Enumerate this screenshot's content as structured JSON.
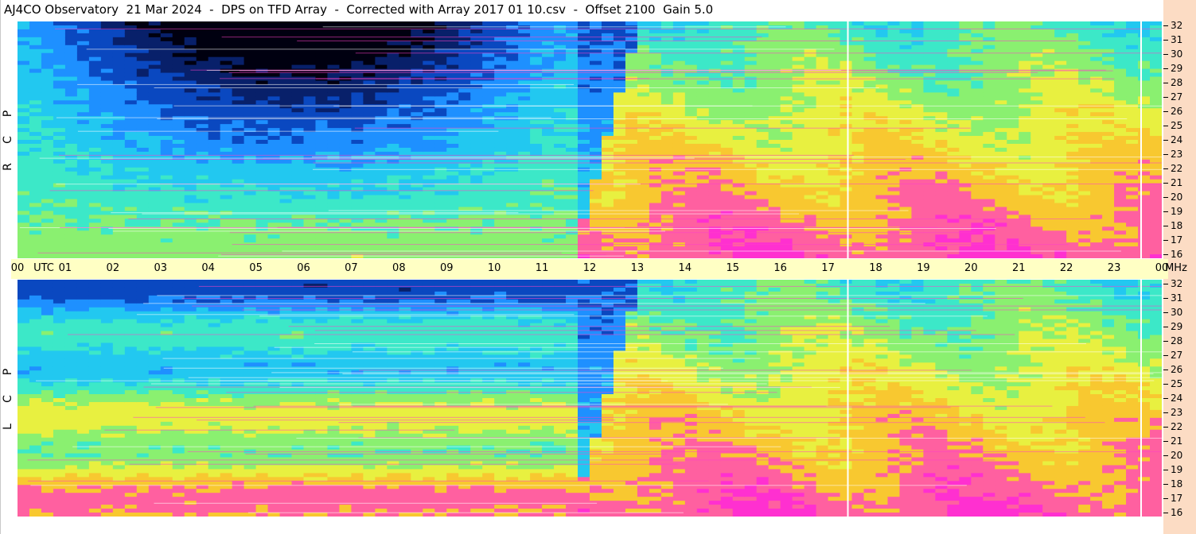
{
  "title": "AJ4CO Observatory  21 Mar 2024  -  DPS on TFD Array  -  Corrected with Array 2017 01 10.csv  -  Offset 2100  Gain 5.0",
  "panels": [
    {
      "id": "top",
      "polarization_letters": [
        "P",
        "C",
        "R"
      ]
    },
    {
      "id": "bot",
      "polarization_letters": [
        "P",
        "C",
        "L"
      ]
    }
  ],
  "time_axis": {
    "labels": [
      "00",
      "01",
      "02",
      "03",
      "04",
      "05",
      "06",
      "07",
      "08",
      "09",
      "10",
      "11",
      "12",
      "13",
      "14",
      "15",
      "16",
      "17",
      "18",
      "19",
      "20",
      "21",
      "22",
      "23",
      "00"
    ],
    "unit_label": "UTC",
    "end_unit_label": "MHz"
  },
  "freq_axis": {
    "labels": [
      "32",
      "31",
      "30",
      "29",
      "28",
      "27",
      "26",
      "25",
      "24",
      "23",
      "22",
      "21",
      "20",
      "19",
      "18",
      "17",
      "16"
    ]
  },
  "colors": {
    "background": "#ffffff",
    "utc_bar": "#ffffc4",
    "mhz_strip": "#fcdcc4",
    "colormap": [
      "#000010",
      "#08206a",
      "#0a48c0",
      "#1e90ff",
      "#22c8f0",
      "#3ce8c8",
      "#8af070",
      "#e8f040",
      "#f8c830",
      "#ff60a0",
      "#ff30d0",
      "#ffffff"
    ]
  },
  "chart_data": {
    "type": "heatmap",
    "x_range_utc_hours": [
      0,
      24
    ],
    "y_range_mhz": [
      16,
      32
    ],
    "panels": [
      "RCP",
      "LCP"
    ]
  }
}
